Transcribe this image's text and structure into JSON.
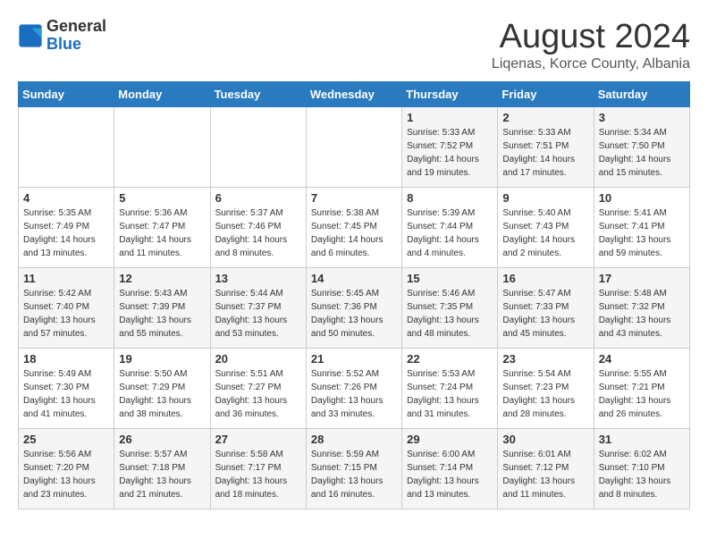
{
  "header": {
    "logo_general": "General",
    "logo_blue": "Blue",
    "title": "August 2024",
    "subtitle": "Liqenas, Korce County, Albania"
  },
  "weekdays": [
    "Sunday",
    "Monday",
    "Tuesday",
    "Wednesday",
    "Thursday",
    "Friday",
    "Saturday"
  ],
  "weeks": [
    [
      {
        "day": "",
        "sunrise": "",
        "sunset": "",
        "daylight": ""
      },
      {
        "day": "",
        "sunrise": "",
        "sunset": "",
        "daylight": ""
      },
      {
        "day": "",
        "sunrise": "",
        "sunset": "",
        "daylight": ""
      },
      {
        "day": "",
        "sunrise": "",
        "sunset": "",
        "daylight": ""
      },
      {
        "day": "1",
        "sunrise": "Sunrise: 5:33 AM",
        "sunset": "Sunset: 7:52 PM",
        "daylight": "Daylight: 14 hours and 19 minutes."
      },
      {
        "day": "2",
        "sunrise": "Sunrise: 5:33 AM",
        "sunset": "Sunset: 7:51 PM",
        "daylight": "Daylight: 14 hours and 17 minutes."
      },
      {
        "day": "3",
        "sunrise": "Sunrise: 5:34 AM",
        "sunset": "Sunset: 7:50 PM",
        "daylight": "Daylight: 14 hours and 15 minutes."
      }
    ],
    [
      {
        "day": "4",
        "sunrise": "Sunrise: 5:35 AM",
        "sunset": "Sunset: 7:49 PM",
        "daylight": "Daylight: 14 hours and 13 minutes."
      },
      {
        "day": "5",
        "sunrise": "Sunrise: 5:36 AM",
        "sunset": "Sunset: 7:47 PM",
        "daylight": "Daylight: 14 hours and 11 minutes."
      },
      {
        "day": "6",
        "sunrise": "Sunrise: 5:37 AM",
        "sunset": "Sunset: 7:46 PM",
        "daylight": "Daylight: 14 hours and 8 minutes."
      },
      {
        "day": "7",
        "sunrise": "Sunrise: 5:38 AM",
        "sunset": "Sunset: 7:45 PM",
        "daylight": "Daylight: 14 hours and 6 minutes."
      },
      {
        "day": "8",
        "sunrise": "Sunrise: 5:39 AM",
        "sunset": "Sunset: 7:44 PM",
        "daylight": "Daylight: 14 hours and 4 minutes."
      },
      {
        "day": "9",
        "sunrise": "Sunrise: 5:40 AM",
        "sunset": "Sunset: 7:43 PM",
        "daylight": "Daylight: 14 hours and 2 minutes."
      },
      {
        "day": "10",
        "sunrise": "Sunrise: 5:41 AM",
        "sunset": "Sunset: 7:41 PM",
        "daylight": "Daylight: 13 hours and 59 minutes."
      }
    ],
    [
      {
        "day": "11",
        "sunrise": "Sunrise: 5:42 AM",
        "sunset": "Sunset: 7:40 PM",
        "daylight": "Daylight: 13 hours and 57 minutes."
      },
      {
        "day": "12",
        "sunrise": "Sunrise: 5:43 AM",
        "sunset": "Sunset: 7:39 PM",
        "daylight": "Daylight: 13 hours and 55 minutes."
      },
      {
        "day": "13",
        "sunrise": "Sunrise: 5:44 AM",
        "sunset": "Sunset: 7:37 PM",
        "daylight": "Daylight: 13 hours and 53 minutes."
      },
      {
        "day": "14",
        "sunrise": "Sunrise: 5:45 AM",
        "sunset": "Sunset: 7:36 PM",
        "daylight": "Daylight: 13 hours and 50 minutes."
      },
      {
        "day": "15",
        "sunrise": "Sunrise: 5:46 AM",
        "sunset": "Sunset: 7:35 PM",
        "daylight": "Daylight: 13 hours and 48 minutes."
      },
      {
        "day": "16",
        "sunrise": "Sunrise: 5:47 AM",
        "sunset": "Sunset: 7:33 PM",
        "daylight": "Daylight: 13 hours and 45 minutes."
      },
      {
        "day": "17",
        "sunrise": "Sunrise: 5:48 AM",
        "sunset": "Sunset: 7:32 PM",
        "daylight": "Daylight: 13 hours and 43 minutes."
      }
    ],
    [
      {
        "day": "18",
        "sunrise": "Sunrise: 5:49 AM",
        "sunset": "Sunset: 7:30 PM",
        "daylight": "Daylight: 13 hours and 41 minutes."
      },
      {
        "day": "19",
        "sunrise": "Sunrise: 5:50 AM",
        "sunset": "Sunset: 7:29 PM",
        "daylight": "Daylight: 13 hours and 38 minutes."
      },
      {
        "day": "20",
        "sunrise": "Sunrise: 5:51 AM",
        "sunset": "Sunset: 7:27 PM",
        "daylight": "Daylight: 13 hours and 36 minutes."
      },
      {
        "day": "21",
        "sunrise": "Sunrise: 5:52 AM",
        "sunset": "Sunset: 7:26 PM",
        "daylight": "Daylight: 13 hours and 33 minutes."
      },
      {
        "day": "22",
        "sunrise": "Sunrise: 5:53 AM",
        "sunset": "Sunset: 7:24 PM",
        "daylight": "Daylight: 13 hours and 31 minutes."
      },
      {
        "day": "23",
        "sunrise": "Sunrise: 5:54 AM",
        "sunset": "Sunset: 7:23 PM",
        "daylight": "Daylight: 13 hours and 28 minutes."
      },
      {
        "day": "24",
        "sunrise": "Sunrise: 5:55 AM",
        "sunset": "Sunset: 7:21 PM",
        "daylight": "Daylight: 13 hours and 26 minutes."
      }
    ],
    [
      {
        "day": "25",
        "sunrise": "Sunrise: 5:56 AM",
        "sunset": "Sunset: 7:20 PM",
        "daylight": "Daylight: 13 hours and 23 minutes."
      },
      {
        "day": "26",
        "sunrise": "Sunrise: 5:57 AM",
        "sunset": "Sunset: 7:18 PM",
        "daylight": "Daylight: 13 hours and 21 minutes."
      },
      {
        "day": "27",
        "sunrise": "Sunrise: 5:58 AM",
        "sunset": "Sunset: 7:17 PM",
        "daylight": "Daylight: 13 hours and 18 minutes."
      },
      {
        "day": "28",
        "sunrise": "Sunrise: 5:59 AM",
        "sunset": "Sunset: 7:15 PM",
        "daylight": "Daylight: 13 hours and 16 minutes."
      },
      {
        "day": "29",
        "sunrise": "Sunrise: 6:00 AM",
        "sunset": "Sunset: 7:14 PM",
        "daylight": "Daylight: 13 hours and 13 minutes."
      },
      {
        "day": "30",
        "sunrise": "Sunrise: 6:01 AM",
        "sunset": "Sunset: 7:12 PM",
        "daylight": "Daylight: 13 hours and 11 minutes."
      },
      {
        "day": "31",
        "sunrise": "Sunrise: 6:02 AM",
        "sunset": "Sunset: 7:10 PM",
        "daylight": "Daylight: 13 hours and 8 minutes."
      }
    ]
  ]
}
